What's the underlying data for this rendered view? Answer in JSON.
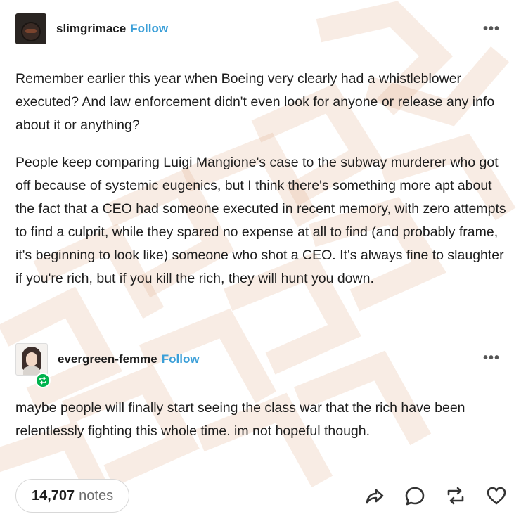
{
  "posts": [
    {
      "username": "slimgrimace",
      "follow_label": "Follow",
      "more_label": "•••",
      "paragraphs": [
        "Remember earlier this year when Boeing very clearly had a whistleblower executed? And law enforcement didn't even look for anyone or release any info about it or anything?",
        "People keep comparing Luigi Mangione's case to the subway murderer who got off because of systemic eugenics, but I think there's something more apt about the fact that a CEO had someone executed in recent memory, with zero attempts to find a culprit, while they spared no expense at all to find (and probably frame, it's beginning to look like) someone who shot a CEO. It's always fine to slaughter if you're rich, but if you kill the rich, they will hunt you down."
      ]
    },
    {
      "username": "evergreen-femme",
      "follow_label": "Follow",
      "more_label": "•••",
      "paragraphs": [
        "maybe people will finally start seeing the class war that the rich have been relentlessly fighting this whole time. im not hopeful though."
      ]
    }
  ],
  "footer": {
    "notes_count": "14,707",
    "notes_label": "notes"
  },
  "icons": [
    "share-icon",
    "reply-icon",
    "reblog-icon",
    "like-icon"
  ],
  "colors": {
    "follow": "#3b9fd8",
    "text": "#1d1d1d",
    "reblog_badge": "#00b34d",
    "watermark": "#deaa82"
  }
}
